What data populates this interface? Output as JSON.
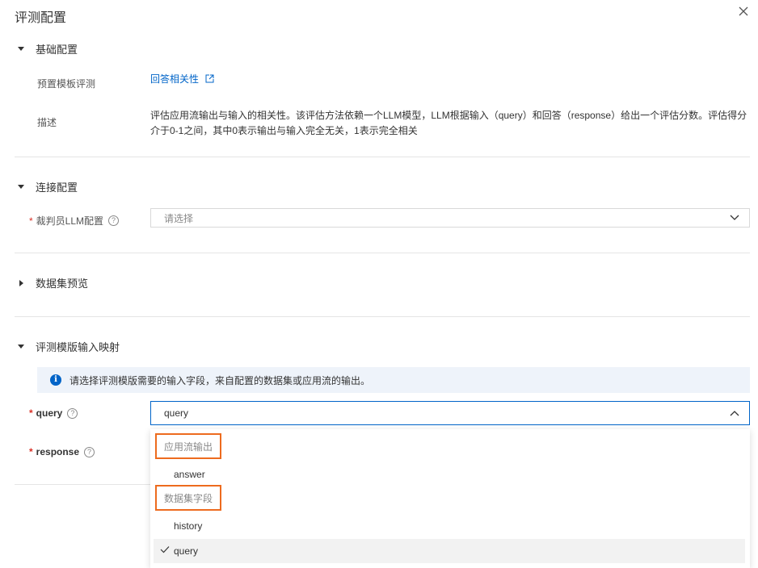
{
  "dialog": {
    "title": "评测配置"
  },
  "basic": {
    "title": "基础配置",
    "template_label": "预置模板评测",
    "template_link": "回答相关性",
    "desc_label": "描述",
    "desc_line1": "评估应用流输出与输入的相关性。该评估方法依赖一个LLM模型，LLM根据输入（query）和回答（response）给出一个评估分数。评估得分",
    "desc_line2": "介于0-1之间，其中0表示输出与输入完全无关，1表示完全相关"
  },
  "connection": {
    "title": "连接配置",
    "required_mark": "*",
    "judge_label": "裁判员LLM配置",
    "judge_placeholder": "请选择"
  },
  "dataset": {
    "title": "数据集预览"
  },
  "mapping": {
    "title": "评测模版输入映射",
    "notice": "请选择评测模版需要的输入字段，来自配置的数据集或应用流的输出。",
    "query_label": "query",
    "query_value": "query",
    "response_label": "response",
    "dropdown": {
      "group1": "应用流输出",
      "opt_answer": "answer",
      "group2": "数据集字段",
      "opt_history": "history",
      "opt_query": "query"
    }
  },
  "colors": {
    "accent": "#0064c8",
    "highlight": "#ed6b1e",
    "required": "#d93026"
  }
}
